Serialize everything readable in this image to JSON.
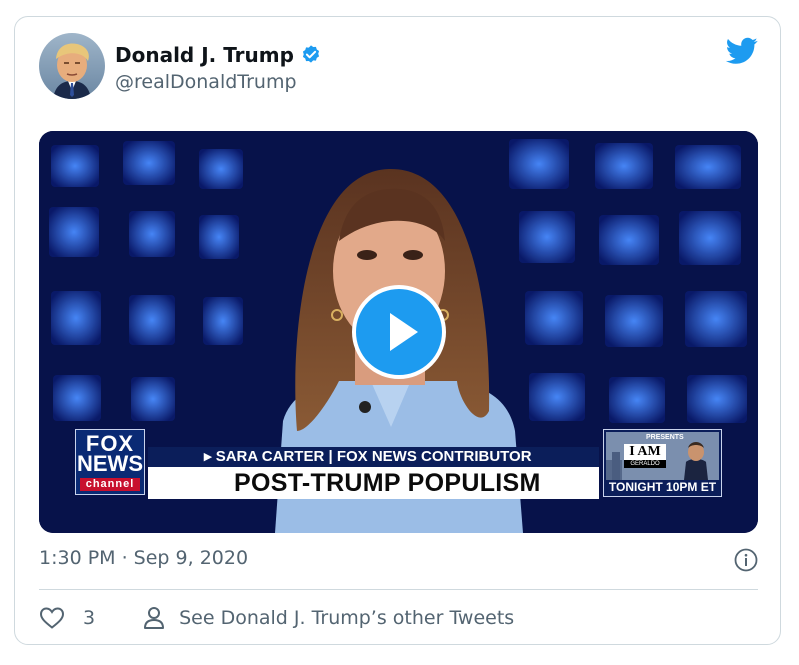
{
  "author": {
    "name": "Donald J. Trump",
    "handle": "@realDonaldTrump",
    "avatar_icon": "avatar-portrait",
    "verified_icon": "verified-badge-icon"
  },
  "brand": {
    "logo_icon": "twitter-bird-icon",
    "accent": "#1d9bf0"
  },
  "media": {
    "type": "video",
    "play_icon": "play-icon",
    "broadcast": {
      "network_logo": [
        "FOX",
        "NEWS",
        "channel"
      ],
      "lower_third_name": "▸ SARA CARTER | FOX NEWS CONTRIBUTOR",
      "lower_third_headline": "POST-TRUMP POPULISM",
      "promo_presents": "PRESENTS",
      "promo_title": "I AM",
      "promo_subtitle": "GERALDO",
      "promo_time": "TONIGHT 10PM ET"
    }
  },
  "timestamp": "1:30 PM · Sep 9, 2020",
  "info_icon": "info-icon",
  "actions": {
    "like_icon": "heart-icon",
    "like_count": "3",
    "profile_icon": "person-icon",
    "other_tweets_label": "See Donald J. Trump’s other Tweets"
  },
  "colors": {
    "text_primary": "#0f1419",
    "text_secondary": "#536471",
    "border": "#cfd9de"
  }
}
